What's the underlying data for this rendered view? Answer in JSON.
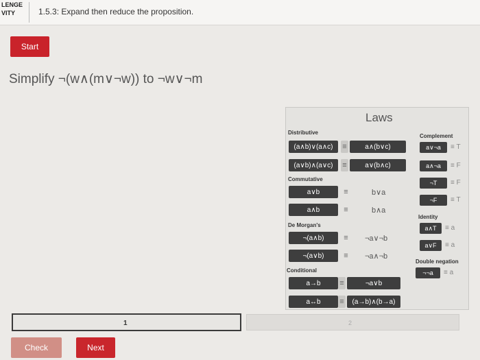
{
  "header": {
    "challenge_label_line1": "LENGE",
    "challenge_label_line2": "VITY",
    "activity_title": "1.5.3: Expand then reduce the proposition."
  },
  "controls": {
    "start_label": "Start",
    "check_label": "Check",
    "next_label": "Next"
  },
  "problem": {
    "text": "Simplify ¬(w∧(m∨¬w)) to ¬w∨¬m"
  },
  "laws": {
    "title": "Laws",
    "sections": {
      "distributive": "Distributive",
      "commutative": "Commutative",
      "demorgans": "De Morgan's",
      "conditional": "Conditional",
      "complement": "Complement",
      "identity": "Identity",
      "double_negation": "Double negation"
    },
    "equiv_symbol": "≡",
    "distributive": [
      {
        "left": "(a∧b)∨(a∧c)",
        "right": "a∧(b∨c)"
      },
      {
        "left": "(a∨b)∧(a∨c)",
        "right": "a∨(b∧c)"
      }
    ],
    "commutative": [
      {
        "left": "a∨b",
        "right": "b∨a"
      },
      {
        "left": "a∧b",
        "right": "b∧a"
      }
    ],
    "demorgans": [
      {
        "left": "¬(a∧b)",
        "right": "¬a∨¬b"
      },
      {
        "left": "¬(a∨b)",
        "right": "¬a∧¬b"
      }
    ],
    "conditional": [
      {
        "left": "a→b",
        "right": "¬a∨b"
      },
      {
        "left": "a↔b",
        "right": "(a→b)∧(b→a)"
      }
    ],
    "complement": [
      {
        "left": "a∨¬a",
        "right": "T"
      },
      {
        "left": "a∧¬a",
        "right": "F"
      },
      {
        "left": "¬T",
        "right": "F"
      },
      {
        "left": "¬F",
        "right": "T"
      }
    ],
    "identity": [
      {
        "left": "a∧T",
        "right": "a"
      },
      {
        "left": "a∨F",
        "right": "a"
      }
    ],
    "double_negation": [
      {
        "left": "¬¬a",
        "right": "a"
      }
    ]
  },
  "progress": {
    "level1": "1",
    "level2": "2",
    "current_level": 1,
    "total_levels": 2
  }
}
